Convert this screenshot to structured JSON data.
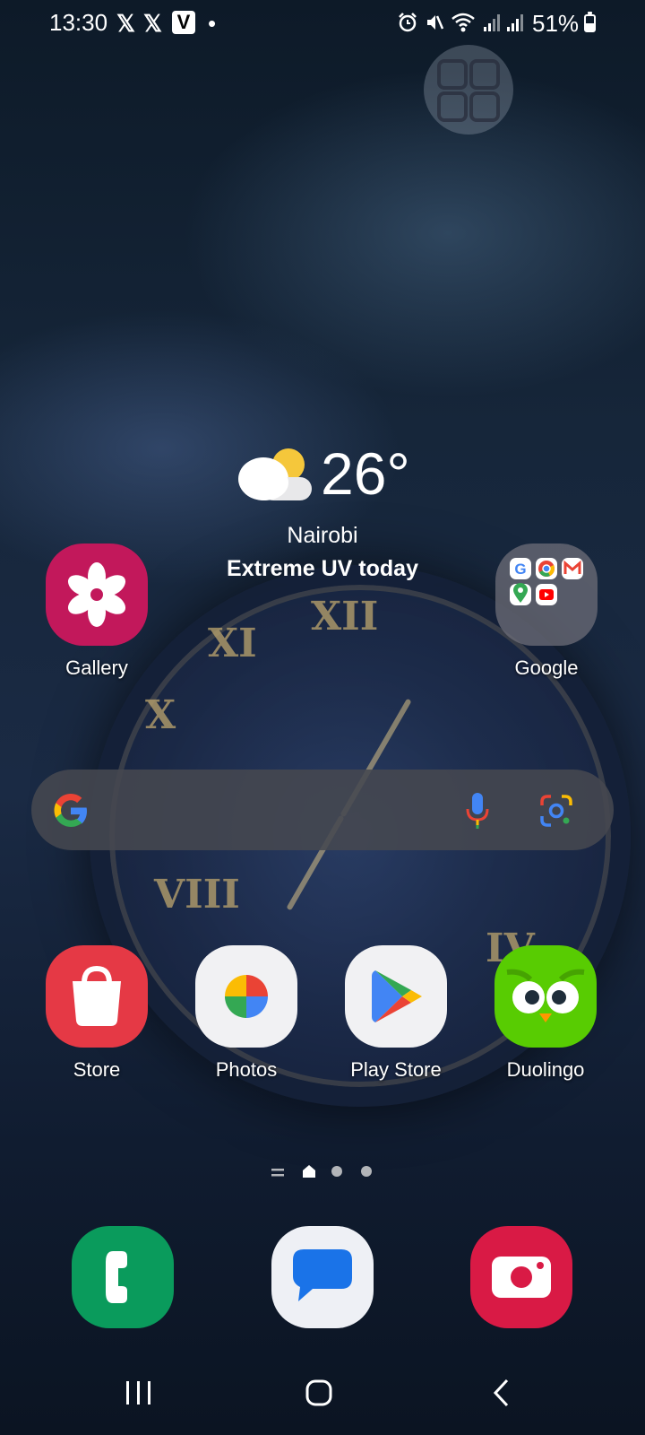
{
  "status_bar": {
    "time": "13:30",
    "notification_icons": [
      "x-icon",
      "x-icon",
      "v-app-icon",
      "dot-icon"
    ],
    "v_letter": "V",
    "system_icons": [
      "alarm-icon",
      "mute-icon",
      "wifi-icon",
      "signal-icon",
      "signal-icon"
    ],
    "battery_percent_text": "51%",
    "battery_level": 0.51
  },
  "weather": {
    "temperature": "26°",
    "city": "Nairobi",
    "alert": "Extreme UV today",
    "icon": "partly-cloudy-icon"
  },
  "home_apps_row1": [
    {
      "label": "Gallery",
      "icon": "gallery-flower-icon"
    },
    {
      "label": "Google",
      "icon": "google-folder-icon"
    }
  ],
  "google_folder_apps": [
    "google-icon",
    "chrome-icon",
    "gmail-icon",
    "maps-icon",
    "youtube-icon"
  ],
  "search": {
    "logo": "google-g-icon",
    "mic": "mic-icon",
    "lens": "lens-icon"
  },
  "home_apps_row2": [
    {
      "label": "Store",
      "icon": "store-bag-icon"
    },
    {
      "label": "Photos",
      "icon": "photos-pinwheel-icon"
    },
    {
      "label": "Play Store",
      "icon": "play-store-icon"
    },
    {
      "label": "Duolingo",
      "icon": "duolingo-owl-icon"
    }
  ],
  "page_indicator": {
    "pages": 3,
    "current": "home"
  },
  "dock": [
    {
      "icon": "phone-icon"
    },
    {
      "icon": "messages-icon"
    },
    {
      "icon": "camera-icon"
    }
  ],
  "nav_bar": [
    "recents-icon",
    "home-icon",
    "back-icon"
  ],
  "colors": {
    "gallery": "#c2185b",
    "store": "#e53945",
    "duolingo": "#58cc02",
    "phone": "#0a9b5c",
    "camera": "#d91a45",
    "search_bar": "#46484f"
  }
}
